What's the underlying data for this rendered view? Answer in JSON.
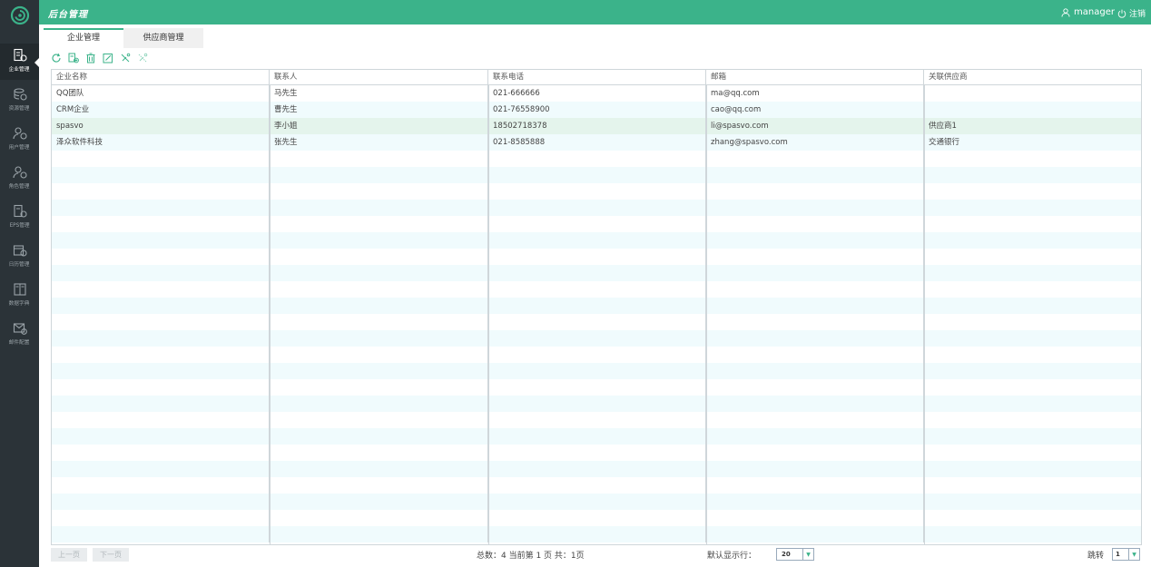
{
  "header": {
    "app_title": "后台管理",
    "user_name": "manager",
    "logout_label": "注销"
  },
  "sidebar": {
    "items": [
      {
        "label": "企业管理",
        "icon": "enterprise-icon",
        "active": true
      },
      {
        "label": "资源管理",
        "icon": "database-icon",
        "active": false
      },
      {
        "label": "用户管理",
        "icon": "user-settings-icon",
        "active": false
      },
      {
        "label": "角色管理",
        "icon": "role-settings-icon",
        "active": false
      },
      {
        "label": "EPS管理",
        "icon": "eps-icon",
        "active": false
      },
      {
        "label": "日历管理",
        "icon": "calendar-icon",
        "active": false
      },
      {
        "label": "数据字典",
        "icon": "dictionary-icon",
        "active": false
      },
      {
        "label": "邮件配置",
        "icon": "mail-config-icon",
        "active": false
      }
    ]
  },
  "tabs": [
    {
      "label": "企业管理",
      "active": true
    },
    {
      "label": "供应商管理",
      "active": false
    }
  ],
  "toolbar": {
    "tools": [
      "refresh-icon",
      "add-icon",
      "delete-icon",
      "edit-icon",
      "link-icon",
      "unlink-icon"
    ]
  },
  "table": {
    "columns": [
      "企业名称",
      "联系人",
      "联系电话",
      "邮箱",
      "关联供应商"
    ],
    "rows": [
      {
        "name": "QQ团队",
        "contact": "马先生",
        "phone": "021-666666",
        "email": "ma@qq.com",
        "supplier": ""
      },
      {
        "name": "CRM企业",
        "contact": "曹先生",
        "phone": "021-76558900",
        "email": "cao@qq.com",
        "supplier": ""
      },
      {
        "name": "spasvo",
        "contact": "李小姐",
        "phone": "18502718378",
        "email": "li@spasvo.com",
        "supplier": "供应商1"
      },
      {
        "name": "泽众软件科技",
        "contact": "张先生",
        "phone": "021-8585888",
        "email": "zhang@spasvo.com",
        "supplier": "交通银行"
      }
    ],
    "selected_row": 2
  },
  "pager": {
    "prev_label": "上一页",
    "next_label": "下一页",
    "summary": "总数：4   当前第 1 页    共：1页",
    "rows_label": "默认显示行：",
    "rows_value": "20",
    "jump_label": "跳转",
    "jump_value": "1"
  },
  "colors": {
    "accent": "#3bb38a",
    "sidebar_bg": "#2b3338",
    "row_alt": "#f0fbfd",
    "row_selected": "#e4f4ec"
  }
}
